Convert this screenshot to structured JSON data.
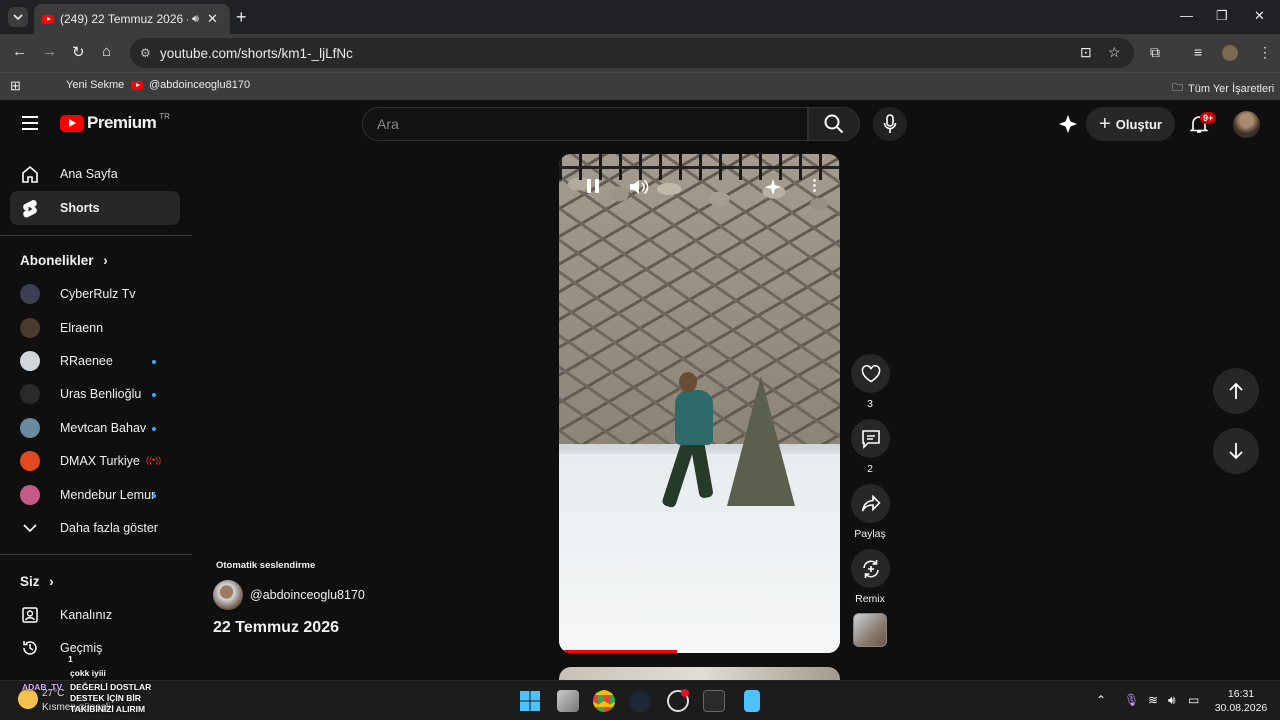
{
  "browser": {
    "tab_title": "(249) 22 Temmuz 2026 - YouTube",
    "url": "youtube.com/shorts/km1-_ljLfNc",
    "bookmarks": [
      "Yeni Sekme",
      "@abdoinceoglu8170"
    ],
    "all_bookmarks": "Tüm Yer İşaretleri"
  },
  "header": {
    "logo_text": "Premium",
    "logo_country": "TR",
    "search_placeholder": "Ara",
    "create_label": "Oluştur",
    "notif_count": "9+"
  },
  "sidebar": {
    "home": "Ana Sayfa",
    "shorts": "Shorts",
    "subscriptions_title": "Abonelikler",
    "subscriptions": [
      {
        "name": "CyberRulz Tv",
        "color": "#3a3f52"
      },
      {
        "name": "Elraenn",
        "color": "#4a3a30"
      },
      {
        "name": "RRaenee",
        "color": "#cfd6dc"
      },
      {
        "name": "Uras Benlioğlu",
        "color": "#2a2a2a"
      },
      {
        "name": "Mevtcan Bahav",
        "color": "#6a8aa0"
      },
      {
        "name": "DMAX Turkiye",
        "color": "#e04a1c"
      },
      {
        "name": "Mendebur Lemur",
        "color": "#c25a8a"
      }
    ],
    "show_more": "Daha fazla göster",
    "you_title": "Siz",
    "your_channel": "Kanalınız",
    "history": "Geçmiş"
  },
  "short": {
    "progress_percent": 42,
    "likes": "3",
    "comments": "2",
    "share_label": "Paylaş",
    "remix_label": "Remix",
    "auto_dub_label": "Otomatik seslendirme",
    "channel": "@abdoinceoglu8170",
    "title": "22 Temmuz 2026"
  },
  "taskbar": {
    "weather_temp": "27°C",
    "weather_desc": "Kısmen güneşli",
    "time": "16:31",
    "date": "30.08.2026",
    "overlay_lines": [
      "çokk iyiii",
      "DEĞERLİ DOSTLAR",
      "DESTEK İÇİN BİR",
      "TAKİBİNİZİ ALIRIM"
    ],
    "overlay_user": "ADAB_TV",
    "overlay_count": "1"
  }
}
